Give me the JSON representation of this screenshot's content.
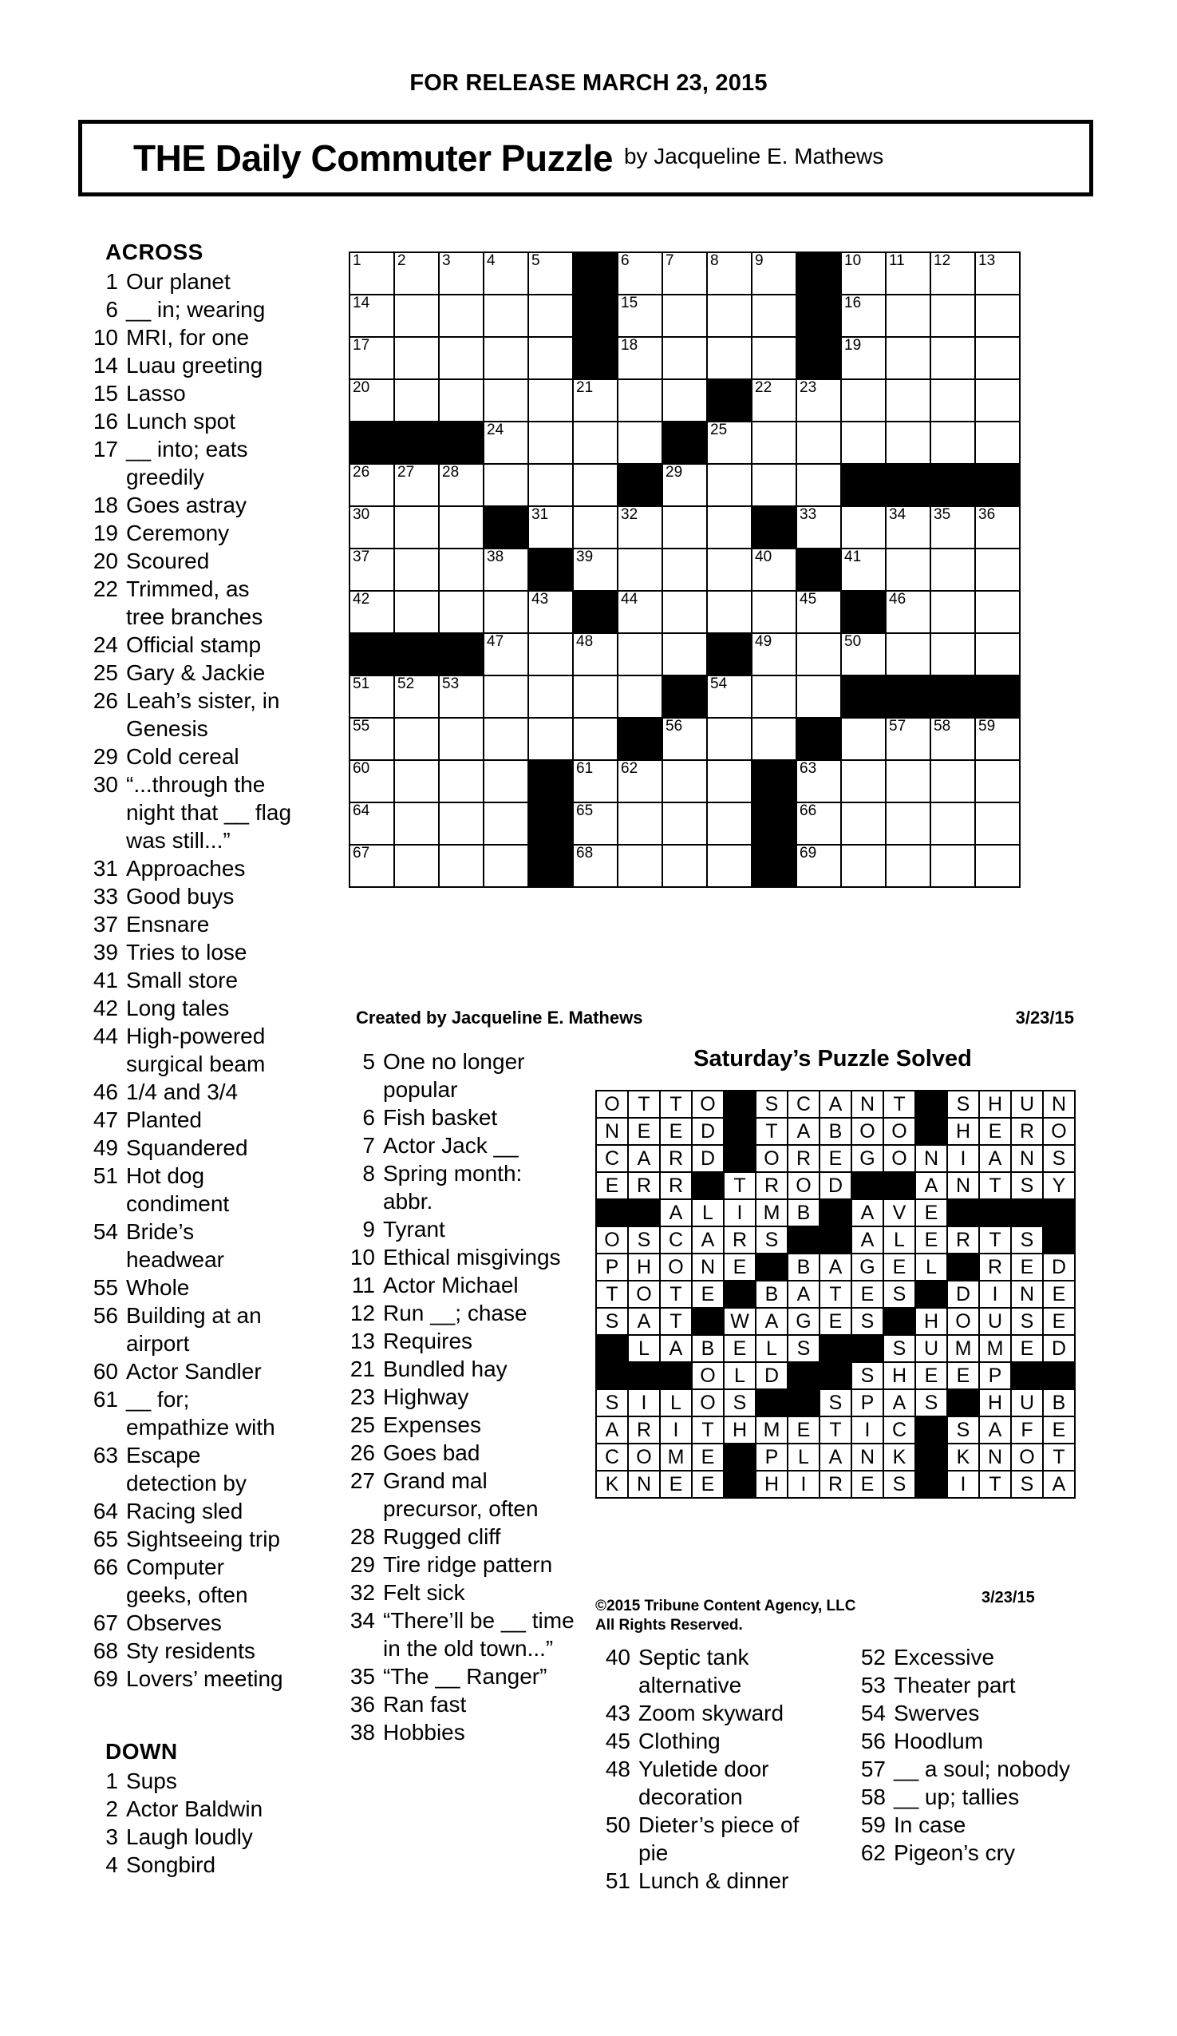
{
  "release_line": "FOR RELEASE MARCH 23, 2015",
  "title": {
    "main": "THE Daily Commuter Puzzle",
    "byline": "by Jacqueline E. Mathews"
  },
  "puzzle_caption": {
    "creator": "Created by Jacqueline E. Mathews",
    "date": "3/23/15"
  },
  "solved_heading": "Saturday’s Puzzle Solved",
  "solution_date": "3/23/15",
  "copyright": {
    "line1": "©2015 Tribune Content Agency, LLC",
    "line2": "All Rights Reserved."
  },
  "across_heading": "ACROSS",
  "down_heading": "DOWN",
  "across": [
    {
      "num": "1",
      "clue": "Our planet"
    },
    {
      "num": "6",
      "clue": "__ in; wearing"
    },
    {
      "num": "10",
      "clue": "MRI, for one"
    },
    {
      "num": "14",
      "clue": "Luau greeting"
    },
    {
      "num": "15",
      "clue": "Lasso"
    },
    {
      "num": "16",
      "clue": "Lunch spot"
    },
    {
      "num": "17",
      "clue": "__ into; eats greedily"
    },
    {
      "num": "18",
      "clue": "Goes astray"
    },
    {
      "num": "19",
      "clue": "Ceremony"
    },
    {
      "num": "20",
      "clue": "Scoured"
    },
    {
      "num": "22",
      "clue": "Trimmed, as tree branches"
    },
    {
      "num": "24",
      "clue": "Official stamp"
    },
    {
      "num": "25",
      "clue": "Gary & Jackie"
    },
    {
      "num": "26",
      "clue": "Leah’s sister, in Genesis"
    },
    {
      "num": "29",
      "clue": "Cold cereal"
    },
    {
      "num": "30",
      "clue": "“...through the night that __ flag was still...”"
    },
    {
      "num": "31",
      "clue": "Approaches"
    },
    {
      "num": "33",
      "clue": "Good buys"
    },
    {
      "num": "37",
      "clue": "Ensnare"
    },
    {
      "num": "39",
      "clue": "Tries to lose"
    },
    {
      "num": "41",
      "clue": "Small store"
    },
    {
      "num": "42",
      "clue": "Long tales"
    },
    {
      "num": "44",
      "clue": "High-powered surgical beam"
    },
    {
      "num": "46",
      "clue": "1/4 and 3/4"
    },
    {
      "num": "47",
      "clue": "Planted"
    },
    {
      "num": "49",
      "clue": "Squandered"
    },
    {
      "num": "51",
      "clue": "Hot dog condiment"
    },
    {
      "num": "54",
      "clue": "Bride’s headwear"
    },
    {
      "num": "55",
      "clue": "Whole"
    },
    {
      "num": "56",
      "clue": "Building at an airport"
    },
    {
      "num": "60",
      "clue": "Actor Sandler"
    },
    {
      "num": "61",
      "clue": "__ for; empathize with"
    },
    {
      "num": "63",
      "clue": "Escape detection by"
    },
    {
      "num": "64",
      "clue": "Racing sled"
    },
    {
      "num": "65",
      "clue": "Sightseeing trip"
    },
    {
      "num": "66",
      "clue": "Computer geeks, often"
    },
    {
      "num": "67",
      "clue": "Observes"
    },
    {
      "num": "68",
      "clue": "Sty residents"
    },
    {
      "num": "69",
      "clue": "Lovers’ meeting"
    }
  ],
  "down_col1": [
    {
      "num": "1",
      "clue": "Sups"
    },
    {
      "num": "2",
      "clue": "Actor Baldwin"
    },
    {
      "num": "3",
      "clue": "Laugh loudly"
    },
    {
      "num": "4",
      "clue": "Songbird"
    }
  ],
  "down_col2": [
    {
      "num": "5",
      "clue": "One no longer popular"
    },
    {
      "num": "6",
      "clue": "Fish basket"
    },
    {
      "num": "7",
      "clue": "Actor Jack __"
    },
    {
      "num": "8",
      "clue": "Spring month: abbr."
    },
    {
      "num": "9",
      "clue": "Tyrant"
    },
    {
      "num": "10",
      "clue": "Ethical misgivings"
    },
    {
      "num": "11",
      "clue": "Actor Michael"
    },
    {
      "num": "12",
      "clue": "Run __; chase"
    },
    {
      "num": "13",
      "clue": "Requires"
    },
    {
      "num": "21",
      "clue": "Bundled hay"
    },
    {
      "num": "23",
      "clue": "Highway"
    },
    {
      "num": "25",
      "clue": "Expenses"
    },
    {
      "num": "26",
      "clue": "Goes bad"
    },
    {
      "num": "27",
      "clue": "Grand mal precursor, often"
    },
    {
      "num": "28",
      "clue": "Rugged cliff"
    },
    {
      "num": "29",
      "clue": "Tire ridge pattern"
    },
    {
      "num": "32",
      "clue": "Felt sick"
    },
    {
      "num": "34",
      "clue": "“There’ll be __ time in the old town...”"
    },
    {
      "num": "35",
      "clue": "“The __ Ranger”"
    },
    {
      "num": "36",
      "clue": "Ran fast"
    },
    {
      "num": "38",
      "clue": "Hobbies"
    }
  ],
  "down_col3": [
    {
      "num": "40",
      "clue": "Septic tank alternative"
    },
    {
      "num": "43",
      "clue": "Zoom skyward"
    },
    {
      "num": "45",
      "clue": "Clothing"
    },
    {
      "num": "48",
      "clue": "Yuletide door decoration"
    },
    {
      "num": "50",
      "clue": "Dieter’s piece of pie"
    },
    {
      "num": "51",
      "clue": "Lunch & dinner"
    }
  ],
  "down_col4": [
    {
      "num": "52",
      "clue": "Excessive"
    },
    {
      "num": "53",
      "clue": "Theater part"
    },
    {
      "num": "54",
      "clue": "Swerves"
    },
    {
      "num": "56",
      "clue": "Hoodlum"
    },
    {
      "num": "57",
      "clue": "__ a soul; nobody"
    },
    {
      "num": "58",
      "clue": "__ up; tallies"
    },
    {
      "num": "59",
      "clue": "In case"
    },
    {
      "num": "62",
      "clue": "Pigeon’s cry"
    }
  ],
  "puzzle_grid": {
    "rows": 15,
    "cols": 15,
    "blocks": [
      [
        0,
        5
      ],
      [
        0,
        10
      ],
      [
        1,
        5
      ],
      [
        1,
        10
      ],
      [
        2,
        5
      ],
      [
        2,
        10
      ],
      [
        3,
        8
      ],
      [
        4,
        0
      ],
      [
        4,
        1
      ],
      [
        4,
        2
      ],
      [
        4,
        7
      ],
      [
        5,
        6
      ],
      [
        5,
        11
      ],
      [
        5,
        12
      ],
      [
        5,
        13
      ],
      [
        5,
        14
      ],
      [
        6,
        3
      ],
      [
        6,
        9
      ],
      [
        7,
        4
      ],
      [
        7,
        10
      ],
      [
        8,
        5
      ],
      [
        8,
        11
      ],
      [
        9,
        0
      ],
      [
        9,
        1
      ],
      [
        9,
        2
      ],
      [
        9,
        8
      ],
      [
        10,
        7
      ],
      [
        10,
        11
      ],
      [
        10,
        12
      ],
      [
        10,
        13
      ],
      [
        10,
        14
      ],
      [
        11,
        6
      ],
      [
        11,
        10
      ],
      [
        12,
        4
      ],
      [
        12,
        9
      ],
      [
        13,
        4
      ],
      [
        13,
        9
      ],
      [
        14,
        4
      ],
      [
        14,
        9
      ]
    ],
    "numbers": {
      "0-0": "1",
      "0-1": "2",
      "0-2": "3",
      "0-3": "4",
      "0-4": "5",
      "0-6": "6",
      "0-7": "7",
      "0-8": "8",
      "0-9": "9",
      "0-11": "10",
      "0-12": "11",
      "0-13": "12",
      "0-14": "13",
      "1-0": "14",
      "1-6": "15",
      "1-11": "16",
      "2-0": "17",
      "2-6": "18",
      "2-11": "19",
      "3-0": "20",
      "3-5": "21",
      "3-9": "22",
      "3-10": "23",
      "4-3": "24",
      "4-8": "25",
      "5-0": "26",
      "5-1": "27",
      "5-2": "28",
      "5-7": "29",
      "6-0": "30",
      "6-4": "31",
      "6-6": "32",
      "6-10": "33",
      "6-12": "34",
      "6-13": "35",
      "6-14": "36",
      "7-0": "37",
      "7-3": "38",
      "7-5": "39",
      "7-9": "40",
      "7-11": "41",
      "8-0": "42",
      "8-4": "43",
      "8-6": "44",
      "8-10": "45",
      "8-12": "46",
      "9-3": "47",
      "9-5": "48",
      "9-9": "49",
      "9-11": "50",
      "10-0": "51",
      "10-1": "52",
      "10-2": "53",
      "10-8": "54",
      "11-0": "55",
      "11-7": "56",
      "11-12": "57",
      "11-13": "58",
      "11-14": "59",
      "12-0": "60",
      "12-5": "61",
      "12-6": "62",
      "12-10": "63",
      "13-0": "64",
      "13-5": "65",
      "13-10": "66",
      "14-0": "67",
      "14-5": "68",
      "14-10": "69"
    }
  },
  "solution_grid": {
    "rows": 15,
    "cols": 15,
    "letters": [
      [
        "O",
        "T",
        "T",
        "O",
        "#",
        "S",
        "C",
        "A",
        "N",
        "T",
        "#",
        "S",
        "H",
        "U",
        "N"
      ],
      [
        "N",
        "E",
        "E",
        "D",
        "#",
        "T",
        "A",
        "B",
        "O",
        "O",
        "#",
        "H",
        "E",
        "R",
        "O"
      ],
      [
        "C",
        "A",
        "R",
        "D",
        "#",
        "O",
        "R",
        "E",
        "G",
        "O",
        "N",
        "I",
        "A",
        "N",
        "S"
      ],
      [
        "E",
        "R",
        "R",
        "#",
        "T",
        "R",
        "O",
        "D",
        "#",
        "#",
        "A",
        "N",
        "T",
        "S",
        "Y"
      ],
      [
        "#",
        "#",
        "A",
        "L",
        "I",
        "M",
        "B",
        "#",
        "A",
        "V",
        "E",
        "#",
        "#",
        "#",
        "#"
      ],
      [
        "O",
        "S",
        "C",
        "A",
        "R",
        "S",
        "#",
        "#",
        "A",
        "L",
        "E",
        "R",
        "T",
        "S",
        "#"
      ],
      [
        "P",
        "H",
        "O",
        "N",
        "E",
        "#",
        "B",
        "A",
        "G",
        "E",
        "L",
        "#",
        "R",
        "E",
        "D"
      ],
      [
        "T",
        "O",
        "T",
        "E",
        "#",
        "B",
        "A",
        "T",
        "E",
        "S",
        "#",
        "D",
        "I",
        "N",
        "E"
      ],
      [
        "S",
        "A",
        "T",
        "#",
        "W",
        "A",
        "G",
        "E",
        "S",
        "#",
        "H",
        "O",
        "U",
        "S",
        "E"
      ],
      [
        "#",
        "L",
        "A",
        "B",
        "E",
        "L",
        "S",
        "#",
        "#",
        "S",
        "U",
        "M",
        "M",
        "E",
        "D"
      ],
      [
        "#",
        "#",
        "#",
        "O",
        "L",
        "D",
        "#",
        "#",
        "S",
        "H",
        "E",
        "E",
        "P",
        "#",
        "#"
      ],
      [
        "S",
        "I",
        "L",
        "O",
        "S",
        "#",
        "#",
        "S",
        "P",
        "A",
        "S",
        "#",
        "H",
        "U",
        "B"
      ],
      [
        "A",
        "R",
        "I",
        "T",
        "H",
        "M",
        "E",
        "T",
        "I",
        "C",
        "#",
        "S",
        "A",
        "F",
        "E"
      ],
      [
        "C",
        "O",
        "M",
        "E",
        "#",
        "P",
        "L",
        "A",
        "N",
        "K",
        "#",
        "K",
        "N",
        "O",
        "T"
      ],
      [
        "K",
        "N",
        "E",
        "E",
        "#",
        "H",
        "I",
        "R",
        "E",
        "S",
        "#",
        "I",
        "T",
        "S",
        "A"
      ]
    ]
  }
}
